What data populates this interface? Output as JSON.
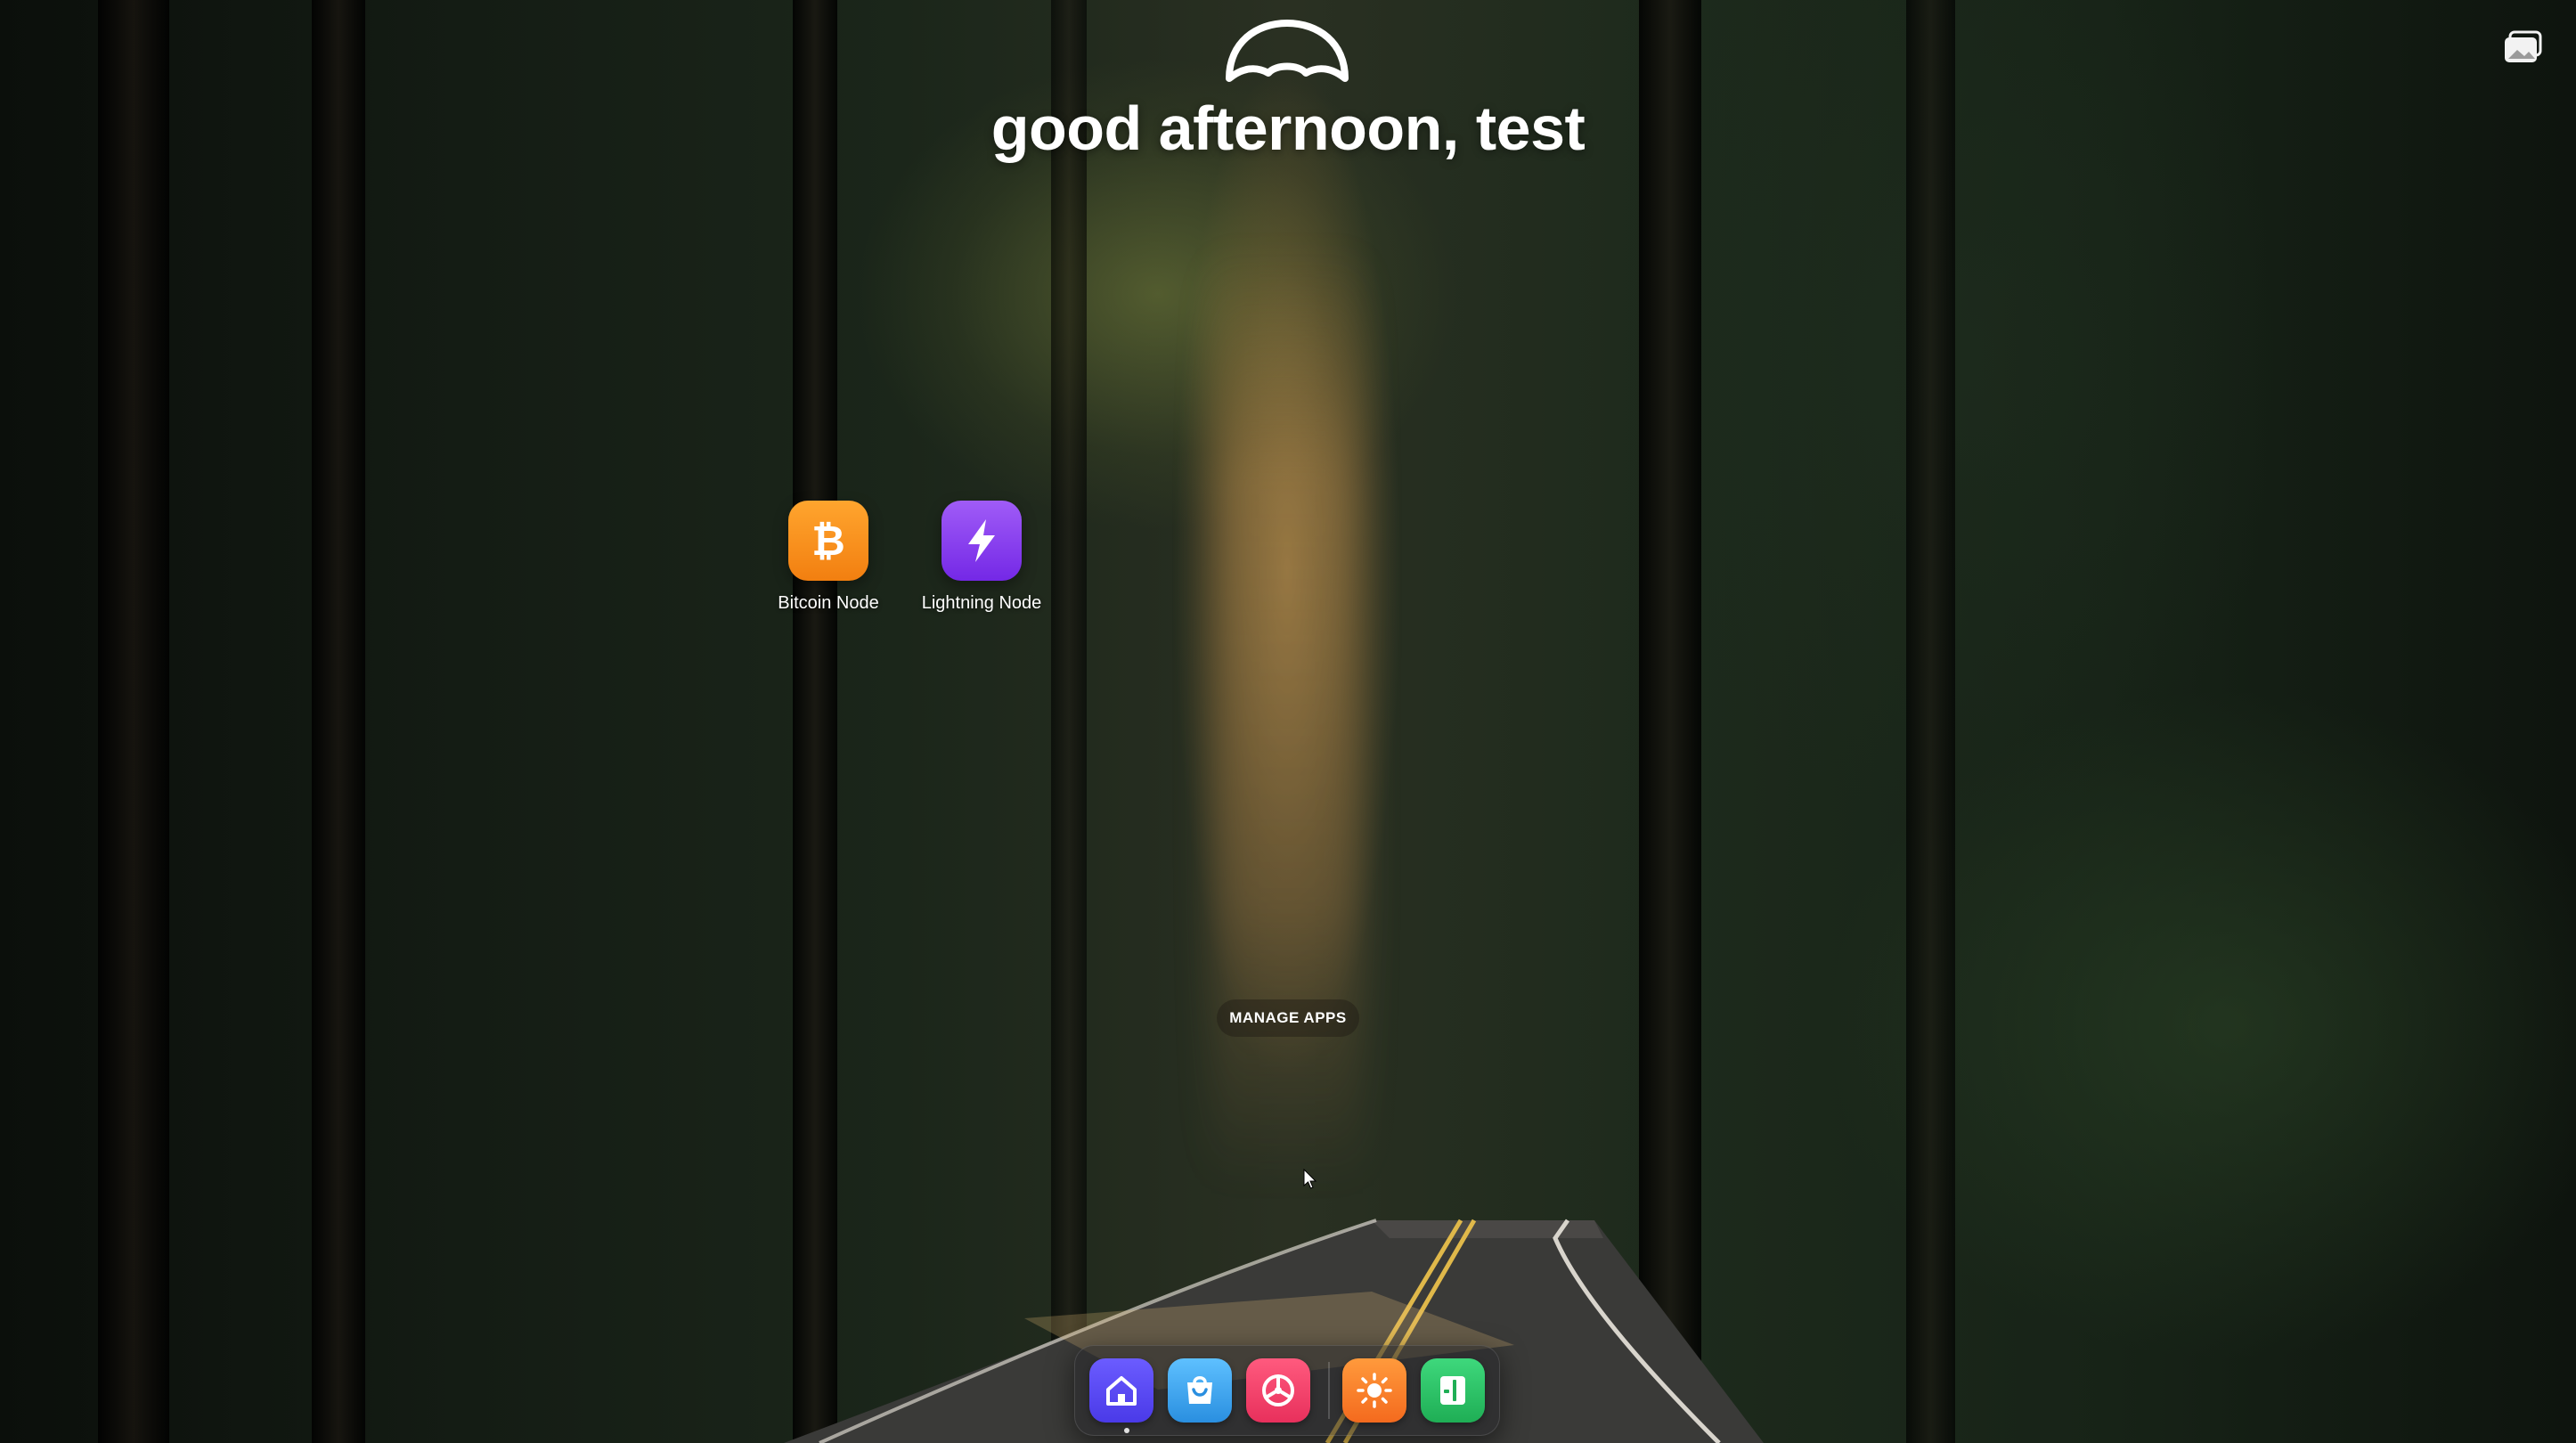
{
  "header": {
    "greeting": "good afternoon, test"
  },
  "apps": [
    {
      "label": "Bitcoin Node",
      "icon": "bitcoin-icon",
      "color": "#f7931a"
    },
    {
      "label": "Lightning Node",
      "icon": "lightning-icon",
      "color": "#8b3cf0"
    }
  ],
  "manage_apps_label": "MANAGE APPS",
  "dock": {
    "items": [
      {
        "name": "home",
        "icon": "home-icon",
        "color": "#5b4cf5"
      },
      {
        "name": "app-store",
        "icon": "shopping-bag-icon",
        "color": "#3aa8f0"
      },
      {
        "name": "settings",
        "icon": "gear-icon",
        "color": "#f0406a"
      },
      {
        "name": "live-usage",
        "icon": "sun-icon",
        "color": "#f97b2a"
      },
      {
        "name": "widgets",
        "icon": "widget-panel-icon",
        "color": "#2ec46a"
      }
    ]
  }
}
